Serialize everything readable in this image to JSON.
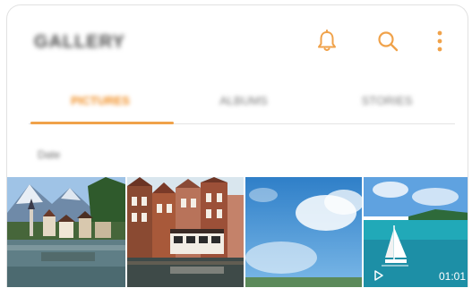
{
  "header": {
    "title": "GALLERY",
    "icons": [
      "notification-bell-icon",
      "search-icon",
      "more-options-icon"
    ]
  },
  "tabs": [
    {
      "label": "PICTURES",
      "active": true
    },
    {
      "label": "ALBUMS",
      "active": false
    },
    {
      "label": "STORIES",
      "active": false
    }
  ],
  "section": {
    "date_label": "Date"
  },
  "thumbnails": [
    {
      "name": "lake-village-photo"
    },
    {
      "name": "canal-houses-photo"
    },
    {
      "name": "sky-clouds-photo"
    },
    {
      "name": "sailboat-video",
      "duration": "01:01"
    }
  ],
  "colors": {
    "accent": "#f08a1c",
    "icon": "#f0a24a"
  }
}
